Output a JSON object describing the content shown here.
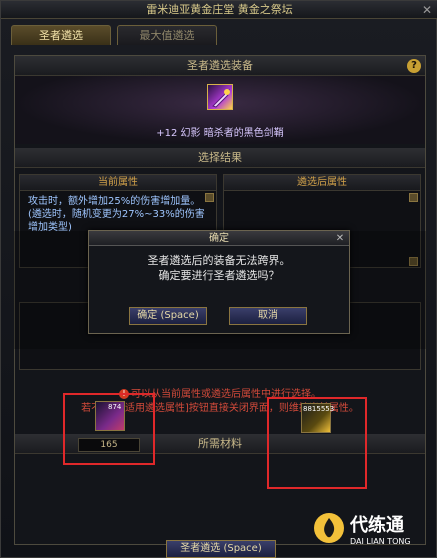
{
  "window": {
    "title": "雷米迪亚黄金庄堂  黄金之祭坛",
    "close_glyph": "✕"
  },
  "tabs": [
    {
      "label": "圣者遴选",
      "active": true
    },
    {
      "label": "最大值遴选",
      "active": false
    }
  ],
  "equipment": {
    "header": "圣者遴选装备",
    "help_glyph": "?",
    "item_name": "+12 幻影  暗杀者的黑色剑鞘"
  },
  "result": {
    "header": "选择结果",
    "current_header": "当前属性",
    "after_header": "遴选后属性",
    "current_text": "攻击时，额外增加25%的伤害增加量。(遴选时，随机变更为27%~33%的伤害增加类型)"
  },
  "notice": {
    "line1": "可以从当前属性或遴选后属性中进行选择。",
    "line2": "若不点击[适用遴选属性]按钮直接关闭界面，则维持当前属性。"
  },
  "materials": {
    "header": "所需材料",
    "item1_count": "874",
    "item1_qty": "165",
    "item2_count": "8815553"
  },
  "bottom_button": "圣者遴选 (Space)",
  "dialog": {
    "title": "确定",
    "close_glyph": "✕",
    "line1": "圣者遴选后的装备无法跨界。",
    "line2": "确定要进行圣者遴选吗？",
    "ok_label": "确定 (Space)",
    "cancel_label": "取消"
  },
  "watermark": {
    "cn": "代练通",
    "en": "DAI LIAN TONG"
  },
  "colors": {
    "accent_gold": "#c9b98a",
    "alert_red": "#e0282a",
    "attr_blue": "#9fc6ff"
  }
}
